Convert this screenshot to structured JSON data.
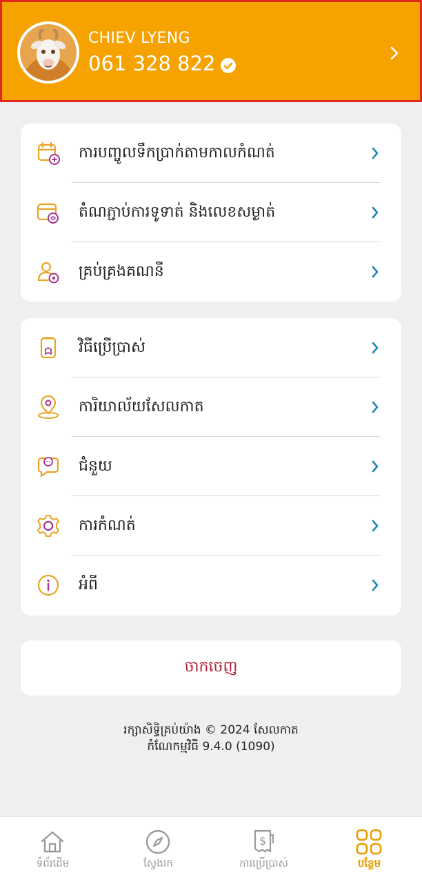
{
  "profile": {
    "name": "CHIEV LYENG",
    "phone": "061 328 822",
    "verified": true
  },
  "group1": [
    {
      "label": "ការបញ្ចូលទឹកប្រាក់តាមកាលកំណត់",
      "icon": "calendar-plus-icon"
    },
    {
      "label": "តំណភ្ជាប់ការទូទាត់ និងលេខសម្ងាត់",
      "icon": "payment-link-icon"
    },
    {
      "label": "គ្រប់គ្រងគណនី",
      "icon": "user-settings-icon"
    }
  ],
  "group2": [
    {
      "label": "វិធីប្រើប្រាស់",
      "icon": "guide-icon"
    },
    {
      "label": "ការិយាល័យសែលកាត",
      "icon": "location-pin-icon"
    },
    {
      "label": "ជំនួយ",
      "icon": "chat-support-icon"
    },
    {
      "label": "ការកំណត់",
      "icon": "gear-icon"
    },
    {
      "label": "អំពី",
      "icon": "info-icon"
    }
  ],
  "logout_label": "ចាកចេញ",
  "footer": {
    "copyright": "រក្សាសិទ្ធិគ្រប់យ៉ាង © 2024 សែលកាត",
    "version": "កំណែកម្មវិធី 9.4.0 (1090)"
  },
  "tabs": [
    {
      "label": "ទំព័រដើម",
      "icon": "home-icon",
      "active": false
    },
    {
      "label": "ស្វែងរក",
      "icon": "compass-icon",
      "active": false
    },
    {
      "label": "ការប្រើប្រាស់",
      "icon": "receipt-icon",
      "active": false
    },
    {
      "label": "បន្ថែម",
      "icon": "grid-icon",
      "active": true
    }
  ],
  "colors": {
    "header": "#f6a201",
    "icon_orange": "#eaa324",
    "icon_purple": "#a6338f",
    "chevron": "#1e86b7",
    "logout": "#b3203a",
    "tab_active": "#e89e00"
  }
}
